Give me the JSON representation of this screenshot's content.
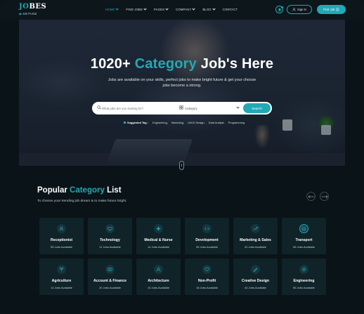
{
  "colors": {
    "accent": "#21a9b5",
    "background": "#0a1317",
    "card": "#0f2329"
  },
  "brand": {
    "name_accent": "JO",
    "name_rest": "BES",
    "tagline": "Job Portal"
  },
  "nav": {
    "items": [
      {
        "label": "HOME",
        "has_dropdown": true,
        "active": true
      },
      {
        "label": "FIND JOBS",
        "has_dropdown": true
      },
      {
        "label": "PAGES",
        "has_dropdown": true
      },
      {
        "label": "COMPANY",
        "has_dropdown": true
      },
      {
        "label": "BLOG",
        "has_dropdown": true
      },
      {
        "label": "CONTACT",
        "has_dropdown": false
      }
    ],
    "sign_in": "Sign In",
    "post_job": "Post Job"
  },
  "hero": {
    "title_prefix": "1020+",
    "title_accent": "Category",
    "title_suffix": "Job's Here",
    "subtitle": "Jobs are available on your skills, perfect jobs to make bright future & get your choose jobs become a strong.",
    "search_placeholder": "What jobs are you looking for?",
    "category_label": "Category",
    "search_button": "Search",
    "suggested_label": "Suggested Tag :",
    "tags": [
      "Engineering,",
      "Marketing,",
      "UI/UX Design,",
      "Data Analyst,",
      "Programming"
    ]
  },
  "categories_section": {
    "title_prefix": "Popular",
    "title_accent": "Category",
    "title_suffix": "List",
    "subtitle": "To choose your trending job dream & to make future bright.",
    "cards": [
      {
        "name": "Receptionist",
        "count": "55 Jobs Available",
        "icon": "reception-icon"
      },
      {
        "name": "Technology",
        "count": "11 Jobs Available",
        "icon": "technology-icon"
      },
      {
        "name": "Medical & Nurse",
        "count": "14 Jobs Available",
        "icon": "medical-icon"
      },
      {
        "name": "Development",
        "count": "35 Jobs Available",
        "icon": "development-icon"
      },
      {
        "name": "Marketing & Sales",
        "count": "20 Jobs Available",
        "icon": "marketing-icon"
      },
      {
        "name": "Transport",
        "count": "56 Jobs Available",
        "icon": "transport-icon"
      },
      {
        "name": "Agriculture",
        "count": "14 Jobs Available",
        "icon": "agriculture-icon"
      },
      {
        "name": "Account & Finance",
        "count": "20 Jobs Available",
        "icon": "finance-icon"
      },
      {
        "name": "Architecture",
        "count": "10 Jobs Available",
        "icon": "architecture-icon"
      },
      {
        "name": "Non-Profit",
        "count": "18 Jobs Available",
        "icon": "non-profit-icon"
      },
      {
        "name": "Creative Design",
        "count": "44 Jobs Available",
        "icon": "creative-icon"
      },
      {
        "name": "Engineering",
        "count": "55 Jobs Available",
        "icon": "engineering-icon"
      }
    ]
  }
}
